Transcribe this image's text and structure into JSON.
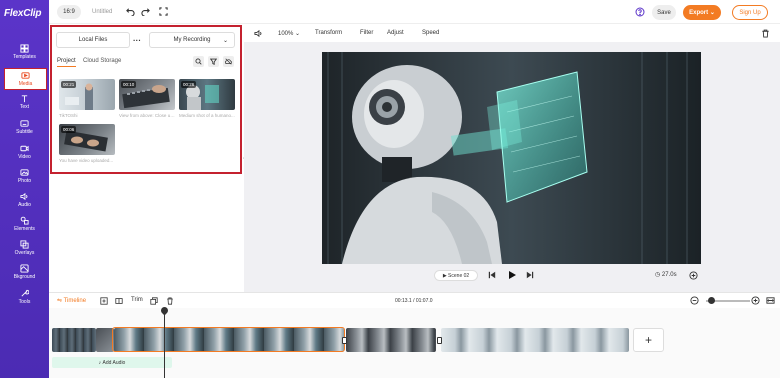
{
  "app": {
    "logo": "FlexClip",
    "ratio": "16:9",
    "title": "Untitled"
  },
  "header": {
    "save_label": "Save",
    "export_label": "Export",
    "signup_label": "Sign Up"
  },
  "sidebar": {
    "items": [
      {
        "label": "Templates",
        "icon": "templates-icon"
      },
      {
        "label": "Media",
        "icon": "media-icon",
        "active": true
      },
      {
        "label": "Text",
        "icon": "text-icon"
      },
      {
        "label": "Subtitle",
        "icon": "subtitle-icon"
      },
      {
        "label": "Video",
        "icon": "video-icon"
      },
      {
        "label": "Photo",
        "icon": "photo-icon"
      },
      {
        "label": "Audio",
        "icon": "audio-icon"
      },
      {
        "label": "Elements",
        "icon": "elements-icon"
      },
      {
        "label": "Overlays",
        "icon": "overlays-icon"
      },
      {
        "label": "Bkground",
        "icon": "background-icon"
      },
      {
        "label": "Tools",
        "icon": "tools-icon"
      }
    ]
  },
  "media_panel": {
    "local_files_label": "Local Files",
    "more_label": "···",
    "recording_label": "My Recording",
    "tabs": {
      "project": "Project",
      "cloud": "Cloud Storage"
    },
    "thumbs": [
      {
        "duration": "00:21",
        "caption": "TikTOShi"
      },
      {
        "duration": "00:10",
        "caption": "View from above: Close up..."
      },
      {
        "duration": "00:26",
        "caption": "Medium shot of a humano..."
      },
      {
        "duration": "00:06",
        "caption": "You have video uploaded..."
      }
    ]
  },
  "edit_toolbar": {
    "zoom": "100%",
    "transform_label": "Transform",
    "filter_label": "Filter",
    "adjust_label": "Adjust",
    "speed_label": "Speed"
  },
  "player": {
    "scene_label": "Scene 02",
    "duration": "27.0s"
  },
  "timeline_bar": {
    "timeline_label": "Timeline",
    "trim_label": "Trim",
    "time": "00:13.1 / 01:07.0"
  },
  "timeline": {
    "add_audio_label": "Add Audio",
    "add_clip_label": "+"
  },
  "colors": {
    "sidebar": "#5b34c9",
    "accent": "#f37b23",
    "highlight": "#c4212f"
  }
}
